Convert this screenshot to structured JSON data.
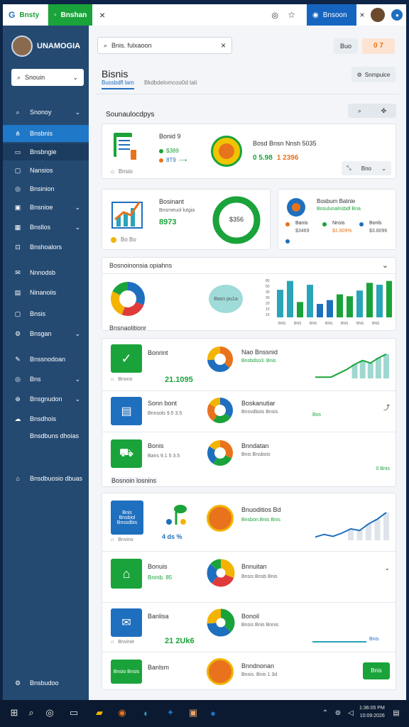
{
  "browser": {
    "tab1": "Bnsty",
    "tab2": "Bnshan",
    "tab3": "Bnsoon",
    "close": "×",
    "colors": {
      "bar": "#ffffff",
      "green_tab": "#1aa33a",
      "blue_tab": "#1565c0"
    }
  },
  "app": {
    "name": "UNAMOGIA",
    "search_placeholder": "Bnis. fulxaoon",
    "header_btn": "Buo",
    "header_nums": "0 7",
    "page_title": "Bisnis",
    "tab_active": "Bussbdfl lam",
    "tab_inactive": "Bkdbdelomcoo0d tali",
    "action_btn": "Snmpuice",
    "section_title": "Sounaulocdpys"
  },
  "sidebar": {
    "select": "Snouin",
    "items": [
      {
        "label": "Snonoy",
        "icon": "search-icon",
        "chevron": "⌄"
      },
      {
        "label": "Bnsbnis",
        "icon": "network-icon",
        "active": true
      },
      {
        "label": "Bnsbngie",
        "icon": "folder-icon",
        "highlight": true
      },
      {
        "label": "Nansios",
        "icon": "doc-icon"
      },
      {
        "label": "Bnsinion",
        "icon": "globe-icon"
      },
      {
        "label": "Bnsnioe",
        "icon": "board-icon",
        "chevron": "⌄"
      },
      {
        "label": "Bnsllos",
        "icon": "table-icon",
        "chevron": "⌄"
      },
      {
        "label": "Bnshoalors",
        "icon": "lock-icon"
      },
      {
        "label": "Nnnodsb",
        "icon": "mail-icon"
      },
      {
        "label": "Ninanoiis",
        "icon": "book-icon"
      },
      {
        "label": "Bnsis",
        "icon": "file-icon"
      },
      {
        "label": "Bnsgan",
        "icon": "gear-icon",
        "chevron": "⌄"
      },
      {
        "label": "Bnssnodoan",
        "icon": "bolt-icon"
      },
      {
        "label": "Bns",
        "icon": "globe-icon",
        "chevron": "⌄"
      },
      {
        "label": "Bnsgnudon",
        "icon": "chart-icon",
        "chevron": "⌄"
      },
      {
        "label": "Bnsdhois",
        "icon": "cloud-icon"
      },
      {
        "label": "Bnsdbuns dhoias",
        "icon": ""
      },
      {
        "label": "Bnsdbuosio dbuas",
        "icon": "home-icon"
      }
    ],
    "footer": "Bnsbudoo"
  },
  "card1": {
    "title": "Bonid 9",
    "line1": "$389",
    "line2": "8T9",
    "footer": "Bnsio",
    "right_title": "Bosd Bnsn Nnsh 5035",
    "right_value1": "0 5.98",
    "right_value2": "1 2396",
    "ctrl": "Bno"
  },
  "card2": {
    "title": "Bosinant",
    "subtitle": "Bnsrneuol lutgia",
    "value": "8973",
    "footer": "Bo Bo",
    "donut_label": "$356"
  },
  "card3": {
    "title": "Bosbum Batnie",
    "subtitle": "Bosulunalnsbdl Bna",
    "cols": [
      "Banis",
      "Nnsis",
      "Bonls"
    ],
    "vals": [
      "$3469",
      "$1.809%",
      "$3.8096"
    ],
    "val_colors": [
      "#555555",
      "#e8731c",
      "#555555"
    ]
  },
  "section2": {
    "title": "Bosnoinonsia opiahns",
    "bubble": "Basn pu1a",
    "bar_ticks": [
      "80",
      "50",
      "30",
      "30",
      "20",
      "10",
      "10"
    ],
    "bar_labels": [
      "BNS",
      "BNS",
      "BNS",
      "BNS",
      "BNS",
      "BNS",
      "BNS"
    ],
    "bars": [
      0.72,
      0.95,
      0.4,
      0.85,
      0.35,
      0.45,
      0.6,
      0.55,
      0.7,
      0.9,
      0.85,
      0.95
    ],
    "bar_colors": [
      "#2aa4b8",
      "#2aa4b8",
      "#1aa33a",
      "#2aa4b8",
      "#1f6fbf",
      "#1f6fbf",
      "#1aa33a",
      "#1aa33a",
      "#2aa4b8",
      "#1aa33a",
      "#2aa4b8",
      "#1aa33a"
    ]
  },
  "section3": {
    "title": "Bnsnaolitionr",
    "rows": [
      {
        "title": "Bonrint",
        "value": "21.1095",
        "footer": "Bnono",
        "right_title": "Nao Bnssnid",
        "right_sub": "Bnsbdso3. Bnis",
        "trend": [
          0.05,
          0.05,
          0.05,
          0.2,
          0.35,
          0.55,
          0.7,
          0.6,
          0.8,
          0.95
        ]
      },
      {
        "title": "Sonn bont",
        "sub": "Bnnsols 9.5 3.5",
        "right_title": "Boskanutiar",
        "right_sub": "Bnsvdbois Bnsis",
        "right_foot": "Bos"
      },
      {
        "title": "Bonis",
        "sub": "Bans 9.1 5 3.5",
        "right_title": "Bnndatan",
        "right_sub": "Bnis Bnsbois",
        "right_foot": "0 Bnis"
      }
    ]
  },
  "section4": {
    "title": "Bosnoin losnins",
    "rows": [
      {
        "box_text": "Bnis Bnsbiol Bnssdbis",
        "footer": "Bnvino",
        "chips": "4 ds %",
        "right_title": "Bnuoditios Bd",
        "right_sub": "Bnsbon.Bnis Bnis",
        "trend": [
          0.1,
          0.18,
          0.12,
          0.22,
          0.35,
          0.3,
          0.5,
          0.65,
          0.85
        ]
      },
      {
        "title": "Bonuis",
        "value": "Bnmb. 85",
        "right_title": "Bnnuitan",
        "right_sub": "Bnsis Bnsb Bnis"
      },
      {
        "title": "Banlisa",
        "value": "21 2Uk6",
        "footer": "Bnvinie",
        "right_title": "Bonoil",
        "right_sub": "Bnsis Bnis Bnnis",
        "right_foot": "Bnis"
      },
      {
        "title": "Banlsm",
        "box_text": "Bnsio Bnsis",
        "right_title": "Bnndnonan",
        "right_sub": "Bnsis. Bnis 1 3d",
        "button": "Bnis"
      }
    ]
  },
  "taskbar": {
    "time": "1:36:05 PM",
    "date": "10:09:2026"
  }
}
